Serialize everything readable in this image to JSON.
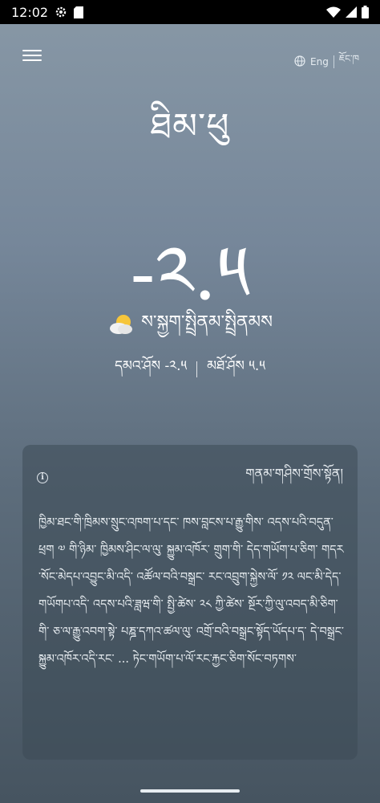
{
  "status_bar": {
    "time": "12:02",
    "icons": [
      "settings-icon",
      "sim-card-icon",
      "wifi-icon",
      "signal-icon",
      "battery-icon"
    ]
  },
  "header": {
    "lang_options": [
      "Eng",
      "ཇོང་ཁ"
    ],
    "icons": [
      "menu-icon",
      "globe-icon"
    ]
  },
  "weather": {
    "city": "ཐིམ་ཕུ",
    "temperature": "-༢.༥",
    "condition": "ས་སྐྱག་སྤྲིནམ་སྤྲིནམས",
    "condition_icon": "partly-cloudy-icon",
    "low": "དམའ་ཤོས -༢.༥",
    "high": "མཐོ་ཤོས ༥.༥"
  },
  "card": {
    "title": "གནམ་གཤིས་གྲོས་སྟོན།",
    "body": "ཁྱིམ་ཐང་གི་ཁྲིམས་སྲུང་འཁག་པ་དང་ ཁས་བླངས་པ་རྒྱུ་གིས་ འདས་པའི་བདུན་ཕྲག ༧ གི་ཉིམ་ ཁྱིམས་ཤིང་ལ་ལུ་ སྐྱུམ་འཁོར་ གྲུག་གི་ དེད་གཡོག་པ་ཅིག་ གདར་སོང་མེདཔ་འབྱུང་མི་འདི་ འཚོལ་བའི་བསྒྲང་ རང་འབྲུག་སྐྱེས་ལོ་ ༡༢ ལང་མི་དེད་གཡོགཔ་འདི་ འདས་པའི་ཟླཝ་གི་ སྤྱི་ཚེས་ ༢༨ ཀྱི་ཚེས་ སྔོར་ཀྱི་ལུ་འབད་མི་ཅིག་གི་ ཅ་ལ་རྒྱུ་འབག་སྟེ་ པཎྜ་དཀའ་ཚལ་ལུ་ འགྲོ་བའི་བསྒྲང་སྟོད་ཡོདཔ་ད་ དེ་བསྒྲང་ སྐྱུམ་འཁོར་འདི་རང་ ... ཏེང་གཡོག་པ་ལོ་རང་རྐྱང་ཅིག་སོང་བཏགས་"
  }
}
